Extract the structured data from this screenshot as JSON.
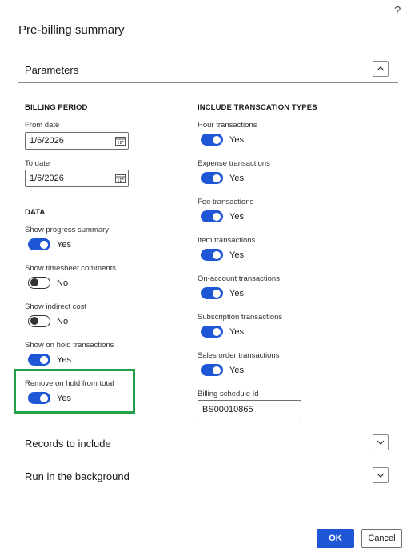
{
  "dialog": {
    "title": "Pre-billing summary",
    "help_glyph": "?"
  },
  "parameters": {
    "title": "Parameters",
    "billing_period": {
      "header": "BILLING PERIOD",
      "from_label": "From date",
      "from_value": "1/6/2026",
      "to_label": "To date",
      "to_value": "1/6/2026"
    },
    "data": {
      "header": "DATA",
      "toggles": [
        {
          "label": "Show progress summary",
          "state": "Yes",
          "on": true
        },
        {
          "label": "Show timesheet comments",
          "state": "No",
          "on": false
        },
        {
          "label": "Show indirect cost",
          "state": "No",
          "on": false
        },
        {
          "label": "Show on hold transactions",
          "state": "Yes",
          "on": true
        },
        {
          "label": "Remove on hold from total",
          "state": "Yes",
          "on": true
        }
      ]
    },
    "transaction_types": {
      "header": "INCLUDE TRANSCATION TYPES",
      "toggles": [
        {
          "label": "Hour transactions",
          "state": "Yes",
          "on": true
        },
        {
          "label": "Expense transactions",
          "state": "Yes",
          "on": true
        },
        {
          "label": "Fee transactions",
          "state": "Yes",
          "on": true
        },
        {
          "label": "Item transactions",
          "state": "Yes",
          "on": true
        },
        {
          "label": "On-account transactions",
          "state": "Yes",
          "on": true
        },
        {
          "label": "Subscription transactions",
          "state": "Yes",
          "on": true
        },
        {
          "label": "Sales order transactions",
          "state": "Yes",
          "on": true
        }
      ],
      "billing_schedule_label": "Billing schedule Id",
      "billing_schedule_value": "BS00010865"
    }
  },
  "records": {
    "title": "Records to include"
  },
  "background": {
    "title": "Run in the background"
  },
  "footer": {
    "ok_label": "OK",
    "cancel_label": "Cancel"
  },
  "colors": {
    "accent": "#1f56d6",
    "highlight": "#22a047"
  }
}
